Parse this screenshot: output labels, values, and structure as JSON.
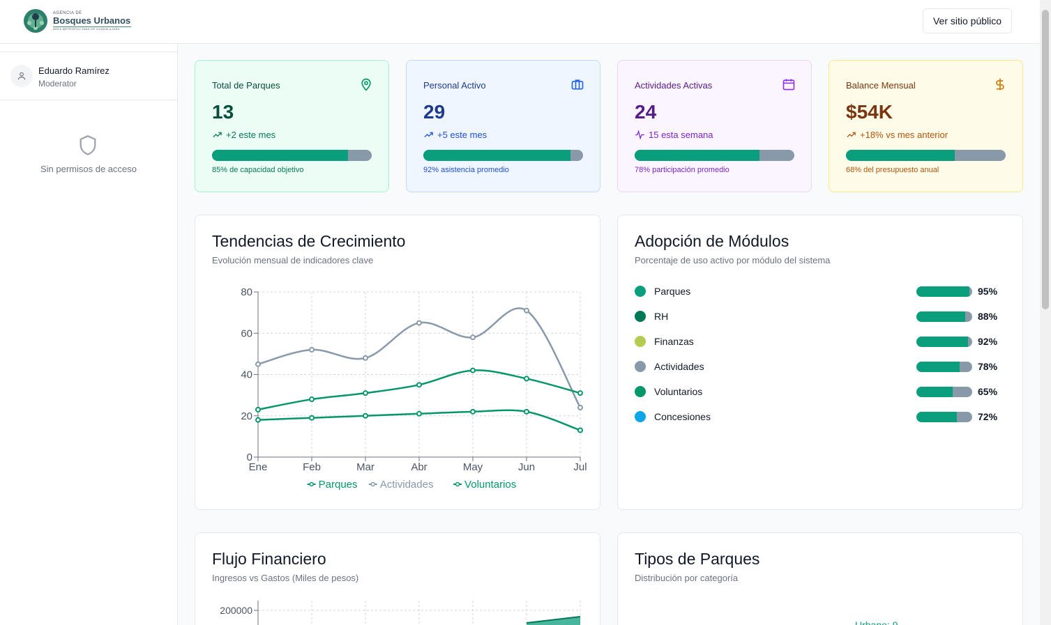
{
  "header": {
    "logo_small": "AGENCIA DE",
    "logo_big": "Bosques Urbanos",
    "logo_tiny": "ÁREA METROPOLITANA DE GUADALAJARA",
    "public_button": "Ver sitio público"
  },
  "sidebar": {
    "user_name": "Eduardo Ramírez",
    "user_role": "Moderator",
    "no_access": "Sin permisos de acceso"
  },
  "stats": [
    {
      "title": "Total de Parques",
      "value": "13",
      "trend": "+2 este mes",
      "progress": 0.85,
      "note": "85% de capacidad objetivo",
      "icon": "map-pin-icon"
    },
    {
      "title": "Personal Activo",
      "value": "29",
      "trend": "+5 este mes",
      "progress": 0.92,
      "note": "92% asistencia promedio",
      "icon": "briefcase-icon"
    },
    {
      "title": "Actividades Activas",
      "value": "24",
      "trend": "15 esta semana",
      "progress": 0.78,
      "note": "78% participación promedio",
      "icon": "calendar-icon"
    },
    {
      "title": "Balance Mensual",
      "value": "$54K",
      "trend": "+18% vs mes anterior",
      "progress": 0.68,
      "note": "68% del presupuesto anual",
      "icon": "dollar-icon"
    }
  ],
  "colors": {
    "accent": "#0a9e7c",
    "track": "#8899aa",
    "green_bg": "#ecfdf5",
    "blue_bg": "#eff6ff",
    "purple_bg": "#faf5ff",
    "yellow_bg": "#fefce8"
  },
  "growth": {
    "title": "Tendencias de Crecimiento",
    "subtitle": "Evolución mensual de indicadores clave"
  },
  "modules": {
    "title": "Adopción de Módulos",
    "subtitle": "Porcentaje de uso activo por módulo del sistema",
    "items": [
      {
        "label": "Parques",
        "pct": "95%",
        "value": 0.95,
        "color": "#0a9e7c"
      },
      {
        "label": "RH",
        "pct": "88%",
        "value": 0.88,
        "color": "#047857"
      },
      {
        "label": "Finanzas",
        "pct": "92%",
        "value": 0.92,
        "color": "#b5cc52"
      },
      {
        "label": "Actividades",
        "pct": "78%",
        "value": 0.78,
        "color": "#8899aa"
      },
      {
        "label": "Voluntarios",
        "pct": "65%",
        "value": 0.65,
        "color": "#059669"
      },
      {
        "label": "Concesiones",
        "pct": "72%",
        "value": 0.72,
        "color": "#0ea5e9"
      }
    ]
  },
  "finance": {
    "title": "Flujo Financiero",
    "subtitle": "Ingresos vs Gastos (Miles de pesos)",
    "y_tick": "200000"
  },
  "park_types": {
    "title": "Tipos de Parques",
    "subtitle": "Distribución por categoría",
    "label_partial": "Urbano: 9"
  },
  "chart_data": [
    {
      "type": "line",
      "title": "Tendencias de Crecimiento",
      "x": [
        "Ene",
        "Feb",
        "Mar",
        "Abr",
        "May",
        "Jun",
        "Jul"
      ],
      "ylim": [
        0,
        80
      ],
      "yticks": [
        "0",
        "20",
        "40",
        "60",
        "80"
      ],
      "grid": true,
      "legend_position": "bottom",
      "series": [
        {
          "name": "Parques",
          "color": "#059669",
          "values": [
            18,
            19,
            20,
            21,
            22,
            22,
            13
          ]
        },
        {
          "name": "Actividades",
          "color": "#8899aa",
          "values": [
            45,
            52,
            48,
            65,
            58,
            71,
            24
          ]
        },
        {
          "name": "Voluntarios",
          "color": "#059669",
          "values": [
            23,
            28,
            31,
            35,
            42,
            38,
            31
          ]
        }
      ]
    },
    {
      "type": "area",
      "title": "Flujo Financiero",
      "note": "only top portion visible; values not readable"
    }
  ]
}
